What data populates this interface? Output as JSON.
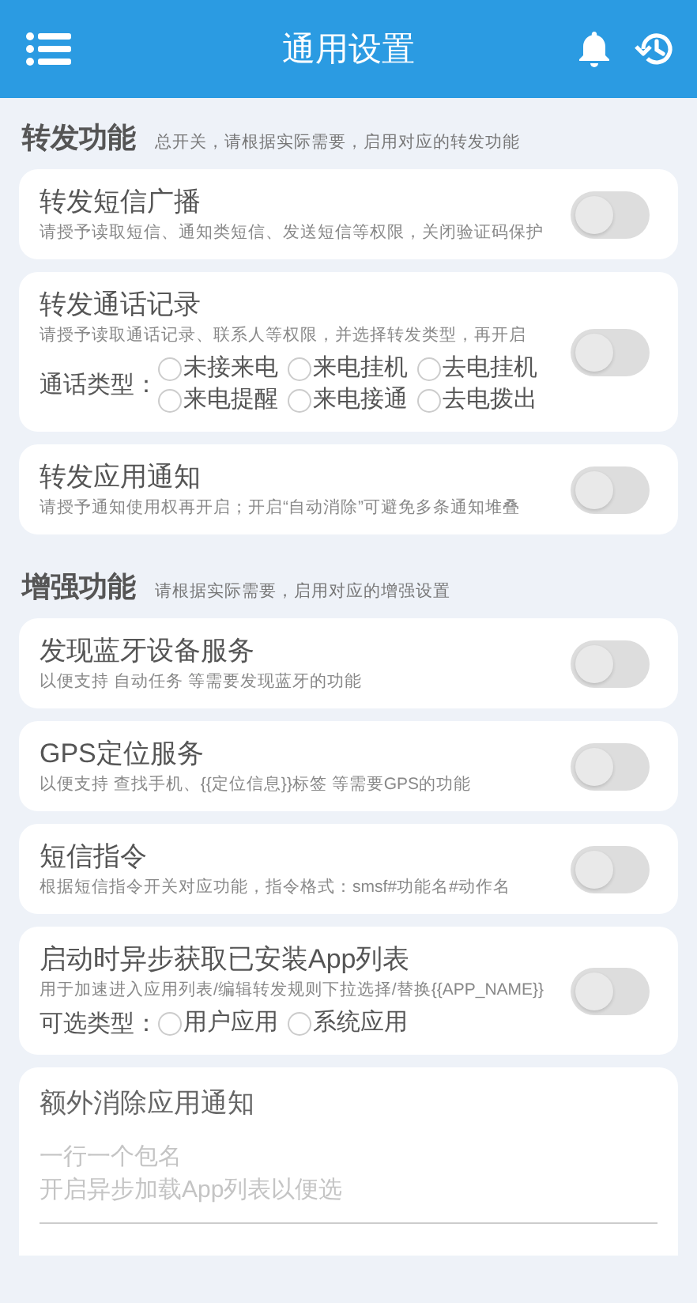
{
  "header": {
    "title": "通用设置"
  },
  "sections": [
    {
      "title": "转发功能",
      "subtitle": "总开关，请根据实际需要，启用对应的转发功能",
      "items": [
        {
          "title": "转发短信广播",
          "description": "请授予读取短信、通知类短信、发送短信等权限，关闭验证码保护",
          "on": false
        },
        {
          "title": "转发通话记录",
          "description": "请授予读取通话记录、联系人等权限，并选择转发类型，再开启",
          "on": false,
          "options_label": "通话类型：",
          "options": [
            {
              "label": "未接来电",
              "selected": false
            },
            {
              "label": "来电挂机",
              "selected": false
            },
            {
              "label": "去电挂机",
              "selected": false
            },
            {
              "label": "来电提醒",
              "selected": false
            },
            {
              "label": "来电接通",
              "selected": false
            },
            {
              "label": "去电拨出",
              "selected": false
            }
          ]
        },
        {
          "title": "转发应用通知",
          "description": "请授予通知使用权再开启；开启“自动消除”可避免多条通知堆叠",
          "on": false
        }
      ]
    },
    {
      "title": "增强功能",
      "subtitle": "请根据实际需要，启用对应的增强设置",
      "items": [
        {
          "title": "发现蓝牙设备服务",
          "description": "以便支持 自动任务 等需要发现蓝牙的功能",
          "on": false
        },
        {
          "title": "GPS定位服务",
          "description": "以便支持 查找手机、{{定位信息}}标签 等需要GPS的功能",
          "on": false
        },
        {
          "title": "短信指令",
          "description": "根据短信指令开关对应功能，指令格式：smsf#功能名#动作名",
          "on": false
        },
        {
          "title": "启动时异步获取已安装App列表",
          "description": "用于加速进入应用列表/编辑转发规则下拉选择/替换{{APP_NAME}}",
          "on": false,
          "options_label": "可选类型：",
          "options": [
            {
              "label": "用户应用",
              "selected": false
            },
            {
              "label": "系统应用",
              "selected": false
            }
          ]
        }
      ]
    }
  ],
  "extra": {
    "title": "额外消除应用通知",
    "placeholder": [
      "一行一个包名",
      "开启异步加载App列表以便选"
    ]
  }
}
